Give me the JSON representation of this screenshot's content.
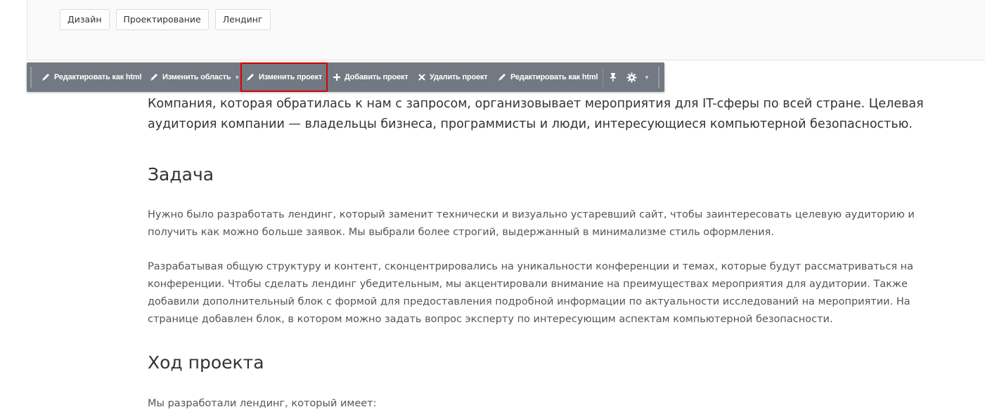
{
  "tags": [
    "Дизайн",
    "Проектирование",
    "Лендинг"
  ],
  "toolbar": {
    "edit_html_1": "Редактировать как html",
    "change_area": "Изменить область",
    "change_project": "Изменить проект",
    "add_project": "Добавить проект",
    "delete_project": "Удалить проект",
    "edit_html_2": "Редактировать как html"
  },
  "article": {
    "lead": "Компания, которая обратилась к нам с запросом, организовывает мероприятия для IT-сферы по всей стране. Целевая аудитория компании — владельцы бизнеса, программисты и люди, интересующиеся компьютерной безопасностью.",
    "heading_task": "Задача",
    "task_p1": "Нужно было разработать лендинг, который заменит технически и визуально устаревший сайт, чтобы заинтересовать целевую аудиторию и получить как можно больше заявок. Мы выбрали более строгий, выдержанный в минимализме стиль оформления.",
    "task_p2": "Разрабатывая общую структуру и контент, сконцентрировались на уникальности конференции и темах, которые будут рассматриваться на конференции. Чтобы сделать лендинг убедительным, мы акцентировали внимание на преимуществах мероприятия для аудитории. Также добавили дополнительный блок с формой для предоставления подробной информации по актуальности исследований на мероприятии. На странице добавлен блок, в котором можно задать вопрос эксперту по интересующим аспектам компьютерной безопасности.",
    "heading_progress": "Ход проекта",
    "progress_p1": "Мы разработали лендинг, который имеет:"
  },
  "colors": {
    "toolbar_bg": "#737983",
    "highlight_border": "#d50000",
    "text": "#333333"
  },
  "icons": [
    "pencil-icon",
    "plus-icon",
    "close-icon",
    "pin-icon",
    "gear-icon",
    "chevron-down-icon",
    "drag-handle-icon"
  ]
}
